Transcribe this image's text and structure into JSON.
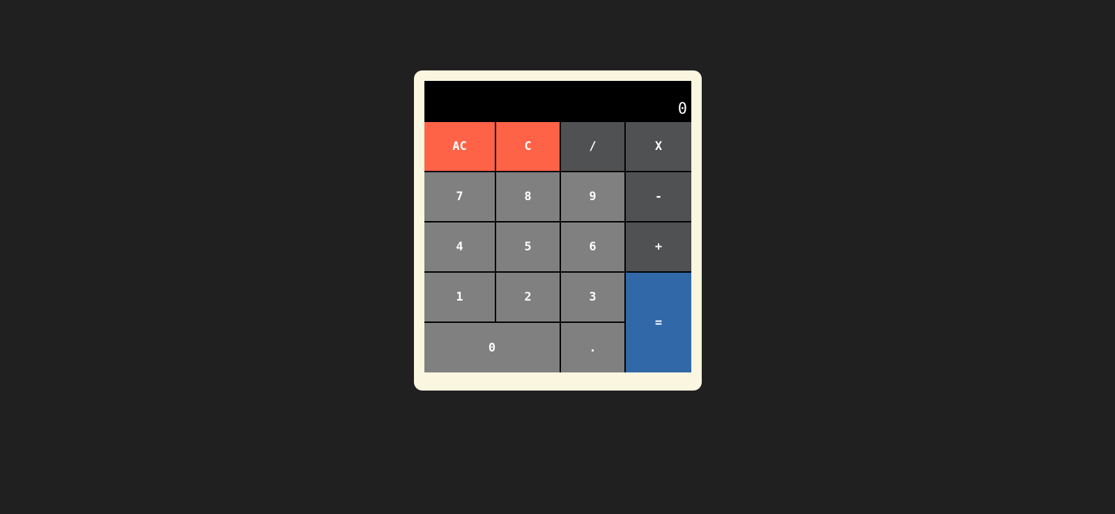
{
  "display": {
    "value": "0"
  },
  "keys": {
    "ac": "AC",
    "c": "C",
    "divide": "/",
    "multiply": "X",
    "seven": "7",
    "eight": "8",
    "nine": "9",
    "minus": "-",
    "four": "4",
    "five": "5",
    "six": "6",
    "plus": "+",
    "one": "1",
    "two": "2",
    "three": "3",
    "equals": "=",
    "zero": "0",
    "decimal": "."
  },
  "colors": {
    "page_background": "#202020",
    "frame": "#faf6e0",
    "display_background": "#000000",
    "number_key": "#808080",
    "operator_key": "#505152",
    "clear_key": "#ff6347",
    "equals_key": "#3169a8"
  }
}
